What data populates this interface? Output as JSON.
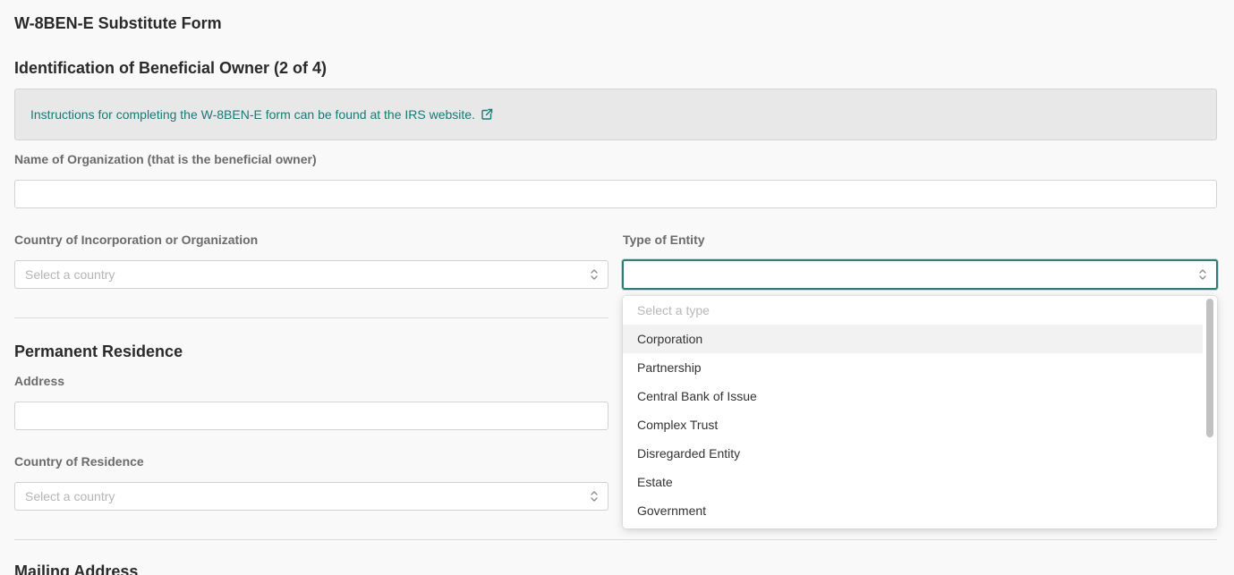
{
  "form": {
    "title": "W-8BEN-E Substitute Form"
  },
  "identification": {
    "title": "Identification of Beneficial Owner (2 of 4)",
    "instructions_link": "Instructions for completing the W-8BEN-E form can be found at the IRS website.",
    "org_name_label": "Name of Organization (that is the beneficial owner)",
    "org_name_value": "",
    "country_label": "Country of Incorporation or Organization",
    "country_placeholder": "Select a country",
    "entity_label": "Type of Entity",
    "entity_value": ""
  },
  "entity_dropdown": {
    "placeholder": "Select a type",
    "options": [
      "Corporation",
      "Partnership",
      "Central Bank of Issue",
      "Complex Trust",
      "Disregarded Entity",
      "Estate",
      "Government"
    ],
    "hovered_index": 0
  },
  "residence": {
    "title": "Permanent Residence",
    "address_label": "Address",
    "address_value": "",
    "country_label": "Country of Residence",
    "country_placeholder": "Select a country"
  },
  "mailing": {
    "title": "Mailing Address"
  },
  "colors": {
    "accent": "#2f7c78",
    "link": "#167a78",
    "info_bg": "#e8e8e8"
  },
  "icons": {
    "external_link": "external-link-icon",
    "select_chevron": "chevron-up-down-icon"
  }
}
